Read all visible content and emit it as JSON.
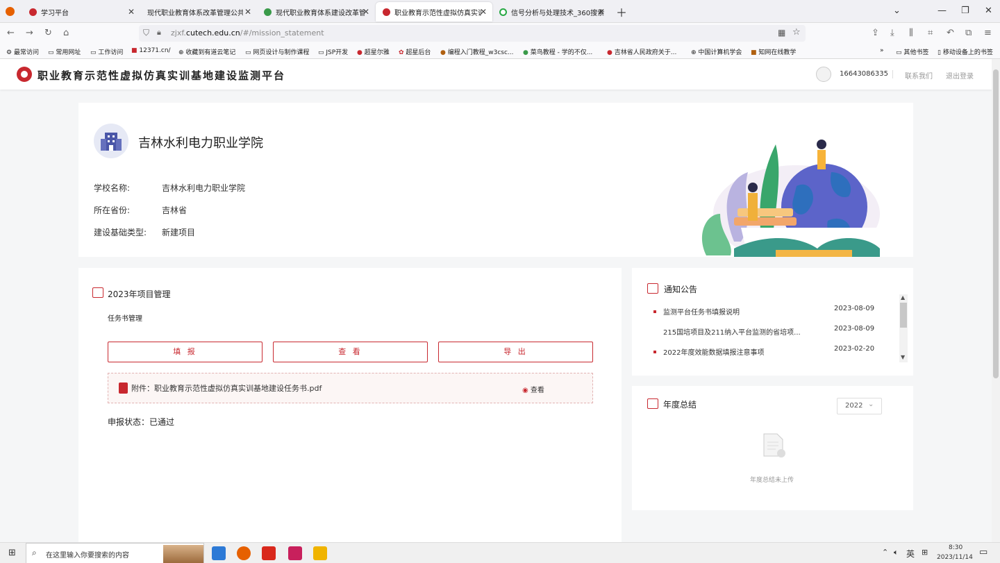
{
  "browser": {
    "tabs": [
      {
        "title": "学习平台",
        "color": "#c8282f"
      },
      {
        "title": "现代职业教育体系改革管理公共信息",
        "color": ""
      },
      {
        "title": "现代职业教育体系建设改革管理",
        "color": "#3a9a4a"
      },
      {
        "title": "职业教育示范性虚拟仿真实训基",
        "color": "#c8282f"
      },
      {
        "title": "信号分析与处理技术_360搜索",
        "color": "#27a844"
      }
    ],
    "url_prefix": "zjxf.",
    "url_domain": "cutech.edu.cn",
    "url_path": "/#/mission_statement",
    "bookmarks": [
      "最常访问",
      "常用网址",
      "工作访问",
      "12371.cn/",
      "收藏到有道云笔记",
      "网页设计与制作课程",
      "JSP开发",
      "超星尔雅",
      "超星后台",
      "编程入门教程_w3csc...",
      "菜鸟教程 - 学的不仅...",
      "吉林省人民政府关于...",
      "中国计算机学会",
      "知网在线教学"
    ],
    "bookmarks_right": [
      "其他书签",
      "移动设备上的书签"
    ]
  },
  "header": {
    "title": "职业教育示范性虚拟仿真实训基地建设监测平台",
    "phone": "16643086335",
    "contact": "联系我们",
    "logout": "退出登录"
  },
  "school": {
    "name": "吉林水利电力职业学院",
    "fields": [
      {
        "label": "学校名称:",
        "value": "吉林水利电力职业学院"
      },
      {
        "label": "所在省份:",
        "value": "吉林省"
      },
      {
        "label": "建设基础类型:",
        "value": "新建项目"
      }
    ]
  },
  "project": {
    "title": "2023年项目管理",
    "subtitle": "任务书管理",
    "buttons": {
      "fill": "填 报",
      "view": "查 看",
      "export": "导 出"
    },
    "attachment": "附件：职业教育示范性虚拟仿真实训基地建设任务书.pdf",
    "attachment_view": "查看",
    "status_label": "申报状态：",
    "status_value": "已通过"
  },
  "notice": {
    "title": "通知公告",
    "items": [
      {
        "text": "监测平台任务书填报说明",
        "date": "2023-08-09"
      },
      {
        "text": "215国培项目及211纳入平台监测的省培项...",
        "date": "2023-08-09"
      },
      {
        "text": "2022年度效能数据填报注意事项",
        "date": "2023-02-20"
      }
    ]
  },
  "annual": {
    "title": "年度总结",
    "year": "2022",
    "empty_text": "年度总结未上传"
  },
  "taskbar": {
    "search_placeholder": "在这里输入你要搜索的内容",
    "ime": "英",
    "time": "8:30",
    "date": "2023/11/14"
  }
}
